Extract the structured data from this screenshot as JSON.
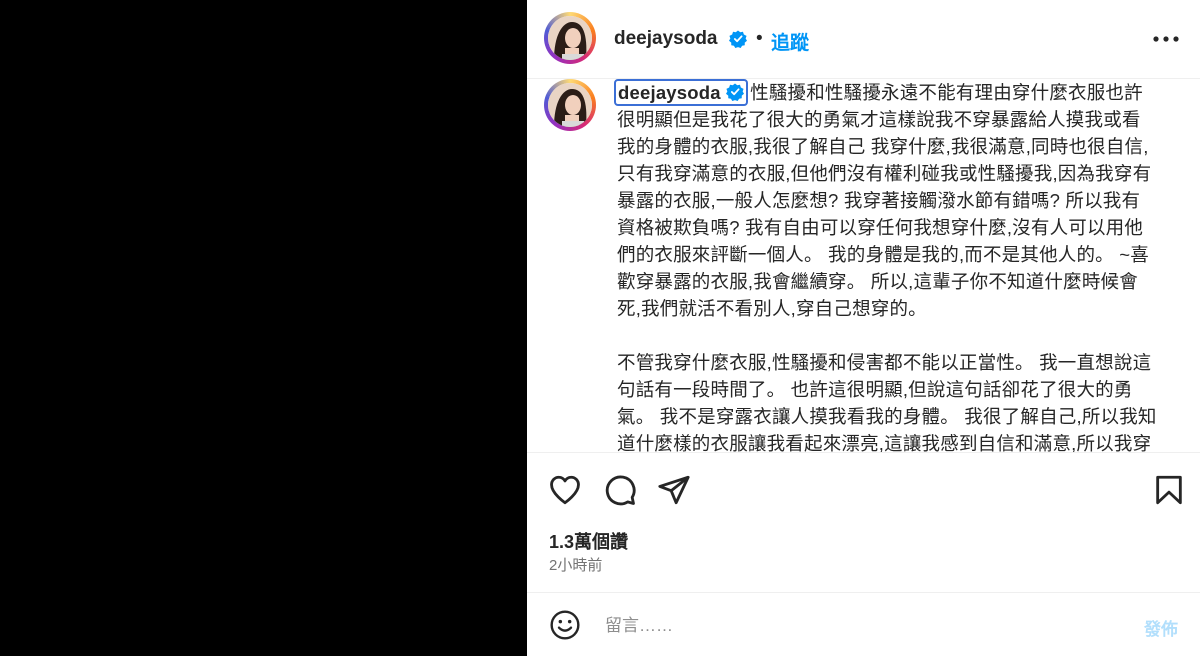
{
  "post": {
    "username": "deejaysoda",
    "follow_label": "追蹤",
    "dot": "•",
    "caption_text": "性騷擾和性騷擾永遠不能有理由穿什麼衣服也許很明顯但是我花了很大的勇氣才這樣說我不穿暴露給人摸我或看我的身體的衣服,我很了解自己 我穿什麼,我很滿意,同時也很自信,只有我穿滿意的衣服,但他們沒有權利碰我或性騷擾我,因為我穿有暴露的衣服,一般人怎麼想? 我穿著接觸潑水節有錯嗎? 所以我有資格被欺負嗎? 我有自由可以穿任何我想穿什麼,沒有人可以用他們的衣服來評斷一個人。 我的身體是我的,而不是其他人的。 ~喜歡穿暴露的衣服,我會繼續穿。 所以,這輩子你不知道什麼時候會死,我們就活不看別人,穿自己想穿的。\n\n不管我穿什麼衣服,性騷擾和侵害都不能以正當性。 我一直想說這句話有一段時間了。 也許這很明顯,但說這句話卻花了很大的勇氣。 我不是穿露衣讓人摸我看我的身體。 我很了解自己,所以我知道什麼樣的衣服讓我看起來漂亮,這讓我感到自信和滿意,所以我穿我想穿的衣服只為了自己滿意。 但他們無權碰我或性騷擾我 因",
    "views": "1.3萬個讚",
    "time_ago": "2小時前"
  },
  "comment": {
    "placeholder": "留言……",
    "post_label": "發佈"
  },
  "icons": {
    "verified": "verified-badge-icon",
    "more": "more-options-icon",
    "like": "heart-icon",
    "comment": "comment-bubble-icon",
    "share": "paper-plane-icon",
    "save": "bookmark-icon",
    "emoji": "emoji-smiley-icon"
  },
  "colors": {
    "accent": "#0095f6",
    "verified": "#0095f6",
    "post_disabled": "#b2dffc",
    "media_bg": "#000000"
  }
}
